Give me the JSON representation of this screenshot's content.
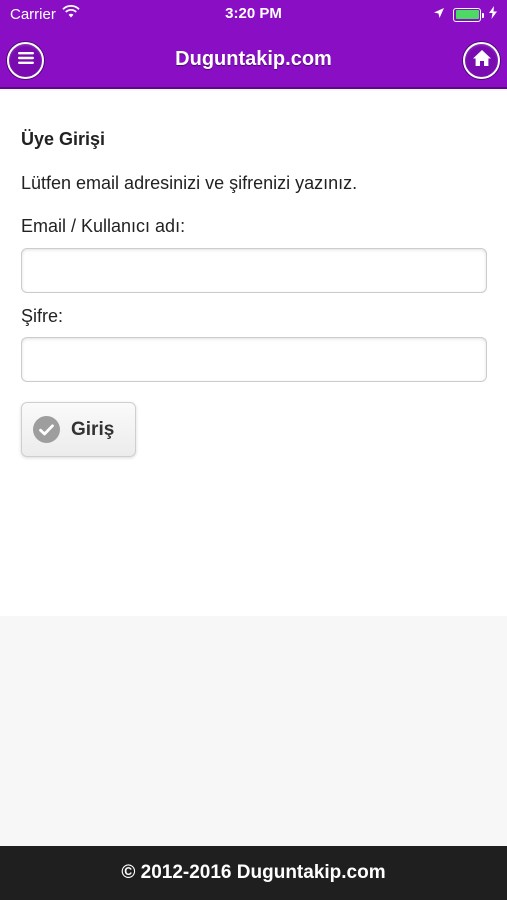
{
  "status_bar": {
    "carrier": "Carrier",
    "time": "3:20 PM",
    "icons": [
      "wifi-icon",
      "location-arrow-icon",
      "battery-icon",
      "charging-icon"
    ]
  },
  "header": {
    "title": "Duguntakip.com",
    "menu_icon": "menu-icon",
    "home_icon": "home-icon",
    "color": "#8a0fc4"
  },
  "login": {
    "heading": "Üye Girişi",
    "instruction": "Lütfen email adresinizi ve şifrenizi yazınız.",
    "email_label": "Email / Kullanıcı adı:",
    "email_value": "",
    "password_label": "Şifre:",
    "password_value": "",
    "submit_label": "Giriş",
    "submit_icon": "check-icon"
  },
  "footer": {
    "text": "© 2012-2016 Duguntakip.com"
  }
}
